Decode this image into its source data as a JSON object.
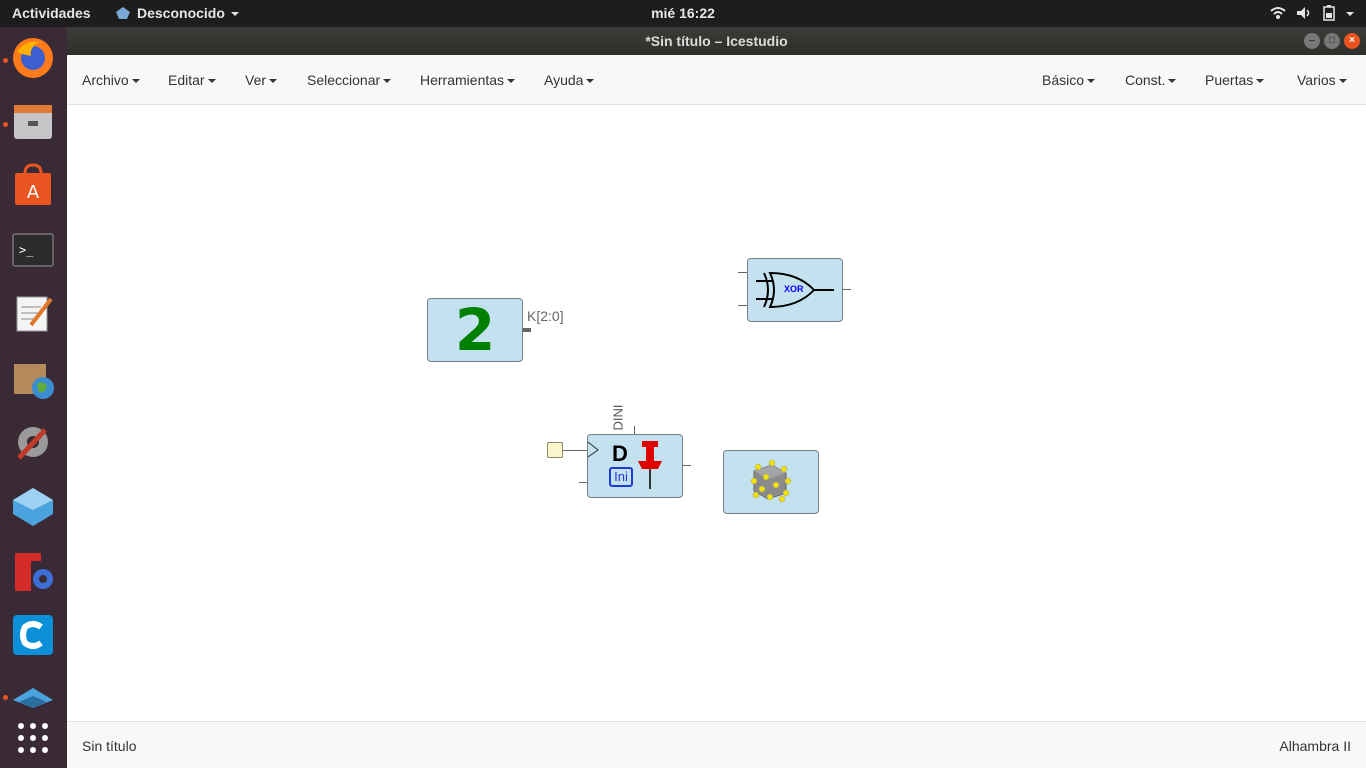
{
  "topbar": {
    "activities": "Actividades",
    "app_name": "Desconocido",
    "clock": "mié 16:22",
    "tray_icons": [
      "wifi-icon",
      "volume-icon",
      "battery-icon",
      "system-menu-icon"
    ]
  },
  "dock": {
    "apps": [
      "firefox",
      "files",
      "software-center",
      "terminal",
      "text-editor",
      "archive-manager",
      "system-tools",
      "icestudio",
      "fpga-tool",
      "cura",
      "app-grid"
    ]
  },
  "window": {
    "title": "*Sin título – Icestudio"
  },
  "menubar": {
    "left": [
      "Archivo",
      "Editar",
      "Ver",
      "Seleccionar",
      "Herramientas",
      "Ayuda"
    ],
    "right": [
      "Básico",
      "Const.",
      "Puertas",
      "Varios"
    ]
  },
  "canvas": {
    "constant_block": {
      "value": "2",
      "label": "K[2:0]"
    },
    "xor_block": {
      "label": "XOR"
    },
    "flipflop_block": {
      "letter": "D",
      "ini_label": "Ini",
      "dini_label": "DINI"
    }
  },
  "statusbar": {
    "left": "Sin título",
    "right": "Alhambra II"
  },
  "colors": {
    "accent": "#e95420",
    "block_fill": "#c3e1ee",
    "constant_text": "#008000",
    "xor_text": "#0000ff"
  }
}
